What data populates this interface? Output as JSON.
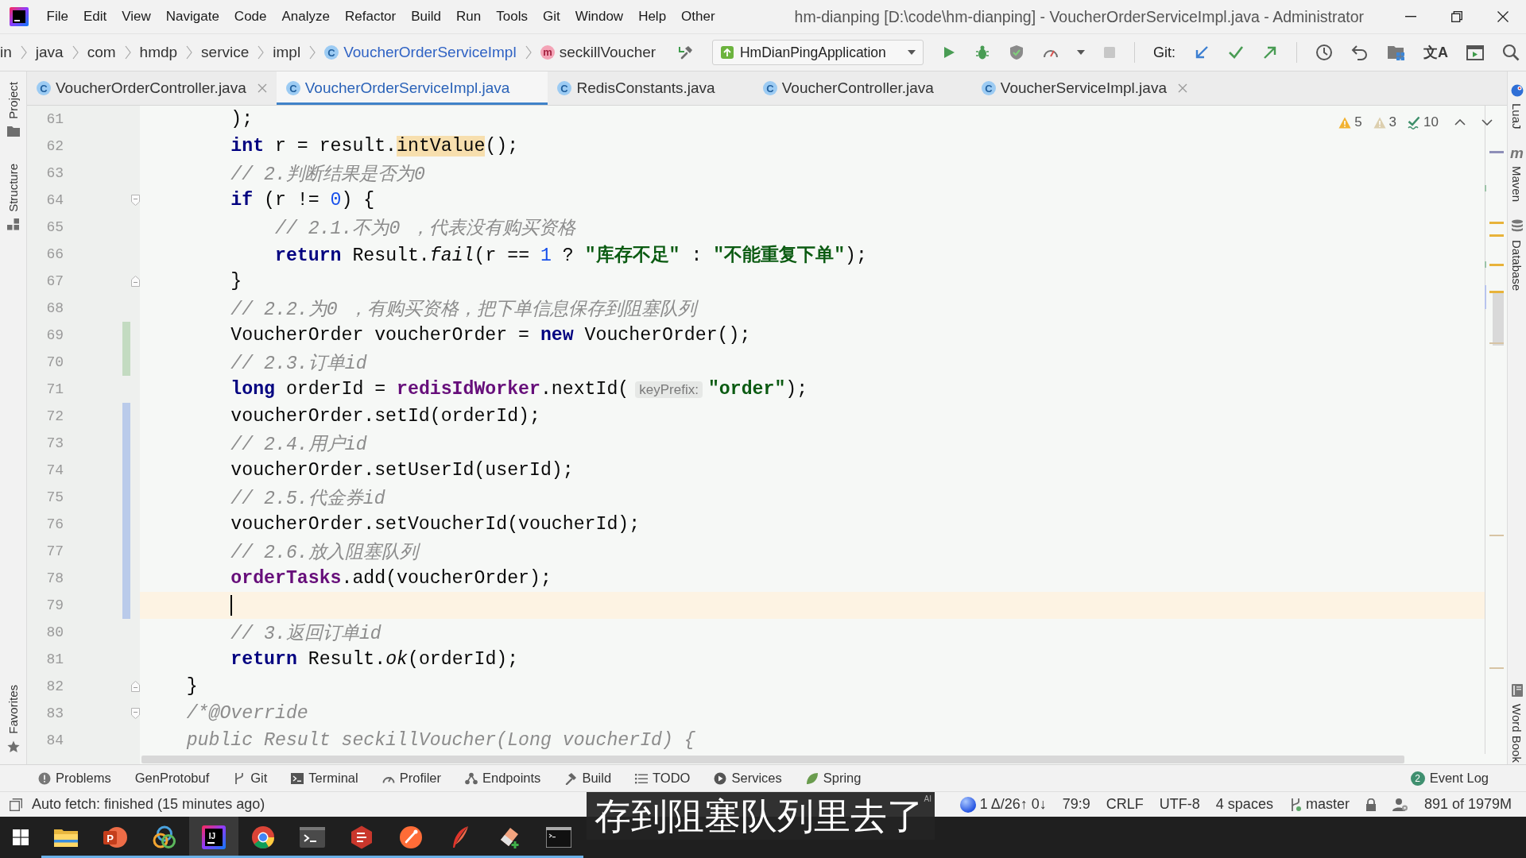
{
  "title_bar": {
    "menu": [
      "File",
      "Edit",
      "View",
      "Navigate",
      "Code",
      "Analyze",
      "Refactor",
      "Build",
      "Run",
      "Tools",
      "Git",
      "Window",
      "Help",
      "Other"
    ],
    "title": "hm-dianping [D:\\code\\hm-dianping] - VoucherOrderServiceImpl.java - Administrator"
  },
  "nav_bar": {
    "breadcrumbs": [
      {
        "kind": "package",
        "label": "in"
      },
      {
        "kind": "package",
        "label": "java"
      },
      {
        "kind": "package",
        "label": "com"
      },
      {
        "kind": "package",
        "label": "hmdp"
      },
      {
        "kind": "package",
        "label": "service"
      },
      {
        "kind": "package",
        "label": "impl"
      },
      {
        "kind": "class",
        "glyph": "C",
        "label": "VoucherOrderServiceImpl"
      },
      {
        "kind": "method",
        "glyph": "m",
        "label": "seckillVoucher"
      }
    ],
    "run_config": "HmDianPingApplication",
    "git_label": "Git:",
    "translate_glyph": "文A"
  },
  "tabs": [
    {
      "glyph": "C",
      "label": "VoucherOrderController.java",
      "selected": false,
      "close_shown": true
    },
    {
      "glyph": "C",
      "label": "VoucherOrderServiceImpl.java",
      "selected": true,
      "close_shown": false
    },
    {
      "glyph": "C",
      "label": "RedisConstants.java",
      "selected": false,
      "close_shown": false
    },
    {
      "glyph": "C",
      "label": "VoucherController.java",
      "selected": false,
      "close_shown": false
    },
    {
      "glyph": "C",
      "label": "VoucherServiceImpl.java",
      "selected": false,
      "close_shown": true
    }
  ],
  "left_strip": {
    "top": [
      {
        "kind": "project",
        "label": "Project"
      },
      {
        "kind": "structure",
        "label": "Structure"
      }
    ],
    "bottom": [
      {
        "kind": "favorites",
        "label": "Favorites"
      }
    ]
  },
  "right_strip": {
    "top": [
      {
        "kind": "luaj",
        "label": "LuaJ"
      },
      {
        "kind": "maven",
        "glyph": "m",
        "label": "Maven"
      },
      {
        "kind": "database",
        "label": "Database"
      }
    ],
    "bottom": [
      {
        "kind": "wordbook",
        "label": "Word Book"
      }
    ]
  },
  "editor": {
    "inspections": [
      {
        "kind": "warning",
        "count": "5"
      },
      {
        "kind": "weak_warning",
        "count": "3"
      },
      {
        "kind": "typo",
        "count": "10"
      }
    ],
    "lines": [
      {
        "number": "61",
        "current": false,
        "caret": false,
        "fold_start": false,
        "fold_end": false,
        "tokens": [
          {
            "kind": "plain",
            "text": "        );"
          }
        ]
      },
      {
        "number": "62",
        "current": false,
        "caret": false,
        "fold_start": false,
        "fold_end": false,
        "tokens": [
          {
            "kind": "keyword",
            "text": "        int"
          },
          {
            "kind": "plain",
            "text": " r = result."
          },
          {
            "kind": "usage",
            "text": "intValue"
          },
          {
            "kind": "plain",
            "text": "();"
          }
        ]
      },
      {
        "number": "63",
        "current": false,
        "caret": false,
        "fold_start": false,
        "fold_end": false,
        "tokens": [
          {
            "kind": "comment",
            "text": "        // 2.判断结果是否为0"
          }
        ]
      },
      {
        "number": "64",
        "current": false,
        "caret": false,
        "fold_start": true,
        "fold_end": false,
        "tokens": [
          {
            "kind": "keyword",
            "text": "        if"
          },
          {
            "kind": "plain",
            "text": " (r != "
          },
          {
            "kind": "number",
            "text": "0"
          },
          {
            "kind": "plain",
            "text": ") {"
          }
        ]
      },
      {
        "number": "65",
        "current": false,
        "caret": false,
        "fold_start": false,
        "fold_end": false,
        "tokens": [
          {
            "kind": "comment",
            "text": "            // 2.1.不为0 ，代表没有购买资格"
          }
        ]
      },
      {
        "number": "66",
        "current": false,
        "caret": false,
        "fold_start": false,
        "fold_end": false,
        "tokens": [
          {
            "kind": "keyword",
            "text": "            return"
          },
          {
            "kind": "plain",
            "text": " Result."
          },
          {
            "kind": "static",
            "text": "fail"
          },
          {
            "kind": "plain",
            "text": "(r == "
          },
          {
            "kind": "number",
            "text": "1"
          },
          {
            "kind": "plain",
            "text": " ? "
          },
          {
            "kind": "string",
            "text": "\"库存不足\""
          },
          {
            "kind": "plain",
            "text": " : "
          },
          {
            "kind": "string",
            "text": "\"不能重复下单\""
          },
          {
            "kind": "plain",
            "text": ");"
          }
        ]
      },
      {
        "number": "67",
        "current": false,
        "caret": false,
        "fold_start": false,
        "fold_end": true,
        "tokens": [
          {
            "kind": "plain",
            "text": "        }"
          }
        ]
      },
      {
        "number": "68",
        "current": false,
        "caret": false,
        "fold_start": false,
        "fold_end": false,
        "tokens": [
          {
            "kind": "comment",
            "text": "        // 2.2.为0 ，有购买资格，把下单信息保存到阻塞队列"
          }
        ]
      },
      {
        "number": "69",
        "current": false,
        "caret": false,
        "fold_start": false,
        "fold_end": false,
        "color": "#c3dbc1",
        "tokens": [
          {
            "kind": "plain",
            "text": "        VoucherOrder voucherOrder = "
          },
          {
            "kind": "keyword",
            "text": "new"
          },
          {
            "kind": "plain",
            "text": " VoucherOrder();"
          }
        ]
      },
      {
        "number": "70",
        "current": false,
        "caret": false,
        "fold_start": false,
        "fold_end": false,
        "color": "#c3dbc1",
        "tokens": [
          {
            "kind": "comment",
            "text": "        // 2.3.订单id"
          }
        ]
      },
      {
        "number": "71",
        "current": false,
        "caret": false,
        "fold_start": false,
        "fold_end": false,
        "tokens": [
          {
            "kind": "keyword",
            "text": "        long"
          },
          {
            "kind": "plain",
            "text": " orderId = "
          },
          {
            "kind": "field",
            "text": "redisIdWorker"
          },
          {
            "kind": "plain",
            "text": ".nextId("
          },
          {
            "kind": "hint",
            "text": "keyPrefix:"
          },
          {
            "kind": "string",
            "text": "\"order\""
          },
          {
            "kind": "plain",
            "text": ");"
          }
        ]
      },
      {
        "number": "72",
        "current": false,
        "caret": false,
        "fold_start": false,
        "fold_end": false,
        "color": "#bacbea",
        "tokens": [
          {
            "kind": "plain",
            "text": "        voucherOrder.setId(orderId);"
          }
        ]
      },
      {
        "number": "73",
        "current": false,
        "caret": false,
        "fold_start": false,
        "fold_end": false,
        "color": "#bacbea",
        "tokens": [
          {
            "kind": "comment",
            "text": "        // 2.4.用户id"
          }
        ]
      },
      {
        "number": "74",
        "current": false,
        "caret": false,
        "fold_start": false,
        "fold_end": false,
        "color": "#bacbea",
        "tokens": [
          {
            "kind": "plain",
            "text": "        voucherOrder.setUserId(userId);"
          }
        ]
      },
      {
        "number": "75",
        "current": false,
        "caret": false,
        "fold_start": false,
        "fold_end": false,
        "color": "#bacbea",
        "tokens": [
          {
            "kind": "comment",
            "text": "        // 2.5.代金券id"
          }
        ]
      },
      {
        "number": "76",
        "current": false,
        "caret": false,
        "fold_start": false,
        "fold_end": false,
        "color": "#bacbea",
        "tokens": [
          {
            "kind": "plain",
            "text": "        voucherOrder.setVoucherId(voucherId);"
          }
        ]
      },
      {
        "number": "77",
        "current": false,
        "caret": false,
        "fold_start": false,
        "fold_end": false,
        "color": "#bacbea",
        "tokens": [
          {
            "kind": "comment",
            "text": "        // 2.6.放入阻塞队列"
          }
        ]
      },
      {
        "number": "78",
        "current": false,
        "caret": false,
        "fold_start": false,
        "fold_end": false,
        "color": "#bacbea",
        "tokens": [
          {
            "kind": "field",
            "text": "        orderTasks"
          },
          {
            "kind": "plain",
            "text": ".add(voucherOrder);"
          }
        ]
      },
      {
        "number": "79",
        "current": true,
        "caret": true,
        "fold_start": false,
        "fold_end": false,
        "color": "#bacbea"
      },
      {
        "number": "80",
        "current": false,
        "caret": false,
        "fold_start": false,
        "fold_end": false,
        "tokens": [
          {
            "kind": "comment",
            "text": "        // 3.返回订单id"
          }
        ]
      },
      {
        "number": "81",
        "current": false,
        "caret": false,
        "fold_start": false,
        "fold_end": false,
        "tokens": [
          {
            "kind": "keyword",
            "text": "        return"
          },
          {
            "kind": "plain",
            "text": " Result."
          },
          {
            "kind": "static",
            "text": "ok"
          },
          {
            "kind": "plain",
            "text": "(orderId);"
          }
        ]
      },
      {
        "number": "82",
        "current": false,
        "caret": false,
        "fold_start": false,
        "fold_end": true,
        "tokens": [
          {
            "kind": "plain",
            "text": "    }"
          }
        ]
      },
      {
        "number": "83",
        "current": false,
        "caret": false,
        "fold_start": true,
        "fold_end": false,
        "tokens": [
          {
            "kind": "comment",
            "text": "    /*@Override"
          }
        ]
      },
      {
        "number": "84",
        "current": false,
        "caret": false,
        "fold_start": false,
        "fold_end": false,
        "tokens": [
          {
            "kind": "comment",
            "text": "    public Result seckillVoucher(Long voucherId) {"
          }
        ]
      }
    ]
  },
  "tool_windows": {
    "left": [
      {
        "kind": "problems",
        "label": "Problems"
      },
      {
        "kind": "genprotobuf",
        "label": "GenProtobuf"
      },
      {
        "kind": "git",
        "label": "Git"
      },
      {
        "kind": "terminal",
        "label": "Terminal"
      },
      {
        "kind": "profiler",
        "label": "Profiler"
      },
      {
        "kind": "endpoints",
        "label": "Endpoints"
      },
      {
        "kind": "build",
        "label": "Build"
      },
      {
        "kind": "todo",
        "label": "TODO"
      },
      {
        "kind": "services",
        "label": "Services"
      },
      {
        "kind": "spring",
        "label": "Spring"
      }
    ],
    "right": [
      {
        "kind": "event_log",
        "label": "Event Log",
        "badge": "2"
      }
    ]
  },
  "status_bar": {
    "message": "Auto fetch: finished (15 minutes ago)",
    "widgets": [
      {
        "kind": "sync",
        "label": "1 Δ/26↑ 0↓"
      },
      {
        "kind": "text",
        "label": "79:9"
      },
      {
        "kind": "text",
        "label": "CRLF"
      },
      {
        "kind": "text",
        "label": "UTF-8"
      },
      {
        "kind": "text",
        "label": "4 spaces"
      },
      {
        "kind": "branch",
        "label": "master"
      },
      {
        "kind": "lock"
      },
      {
        "kind": "inspector"
      },
      {
        "kind": "text",
        "label": "891 of 1979M"
      }
    ]
  },
  "taskbar": [
    {
      "kind": "start",
      "running": false,
      "selected": false
    },
    {
      "kind": "folder",
      "running": true,
      "selected": false
    },
    {
      "kind": "slides",
      "glyph": "P",
      "running": true,
      "selected": false
    },
    {
      "kind": "rings",
      "running": true,
      "selected": false
    },
    {
      "kind": "ide",
      "glyph": "IJ",
      "running": true,
      "selected": true
    },
    {
      "kind": "browser",
      "running": true,
      "selected": false
    },
    {
      "kind": "terminal",
      "running": true,
      "selected": false
    },
    {
      "kind": "hexagon",
      "running": true,
      "selected": false
    },
    {
      "kind": "disc",
      "running": true,
      "selected": false
    },
    {
      "kind": "feather",
      "running": true,
      "selected": false
    },
    {
      "kind": "eraser",
      "running": true,
      "selected": false
    },
    {
      "kind": "console",
      "running": true,
      "selected": false
    }
  ],
  "subtitle": {
    "text": "存到阻塞队列里去了",
    "mark": "AI"
  }
}
